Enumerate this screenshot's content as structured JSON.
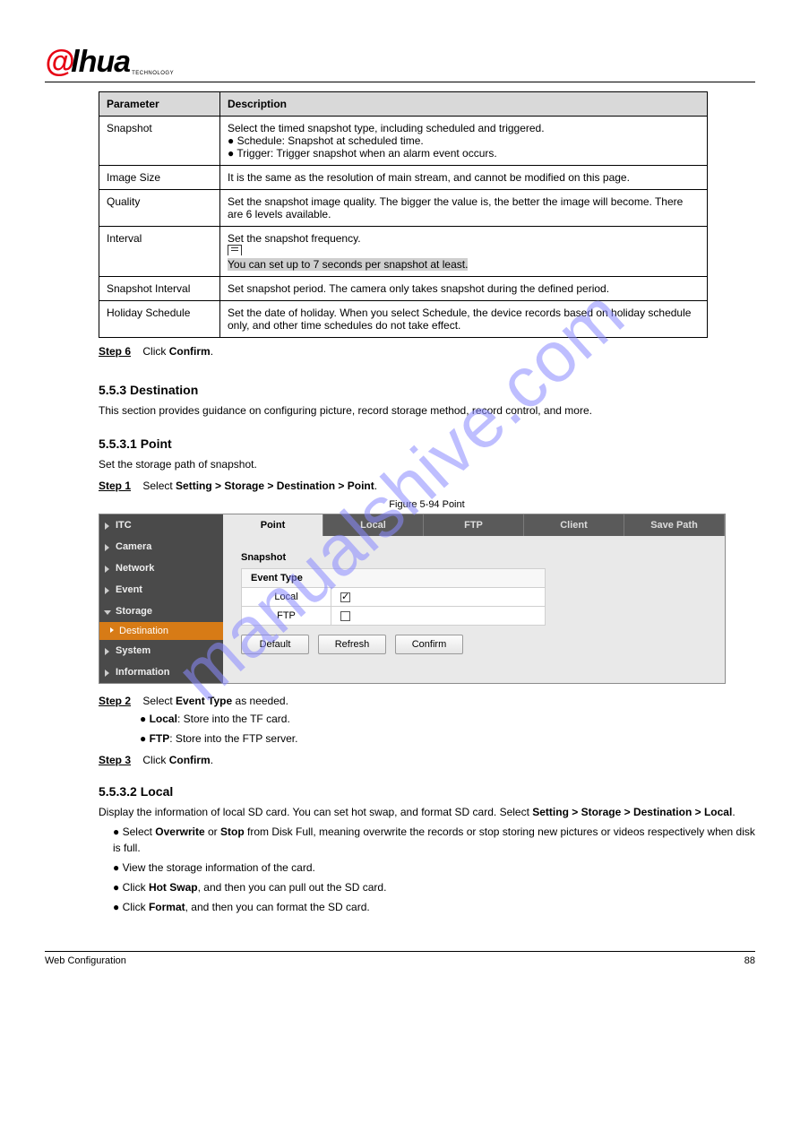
{
  "logo": {
    "first": "@",
    "second": "lhua",
    "tag": "TECHNOLOGY"
  },
  "watermark": "manualshive.com",
  "table": {
    "head": {
      "param": "Parameter",
      "desc": "Description"
    },
    "rows": [
      {
        "param": "Snapshot",
        "desc": "Select the timed snapshot type, including scheduled and triggered.\n● Schedule: Snapshot at scheduled time.\n● Trigger: Trigger snapshot when an alarm event occurs."
      },
      {
        "param": "Image Size",
        "desc": "It is the same as the resolution of main stream, and cannot be modified on this page."
      },
      {
        "param": "Quality",
        "desc": "Set the snapshot image quality. The bigger the value is, the better the image will become. There are 6 levels available."
      },
      {
        "param": "Interval",
        "desc_top": "Set the snapshot frequency.",
        "note": "You can set up to 7 seconds per snapshot at least."
      },
      {
        "param": "Snapshot Interval",
        "desc": "Set snapshot period. The camera only takes snapshot during the defined period."
      },
      {
        "param": "Holiday Schedule",
        "desc": "Set the date of holiday. When you select Schedule, the device records based on holiday schedule only, and other time schedules do not take effect."
      }
    ]
  },
  "step6": {
    "label": "Step 6",
    "text1": "Click ",
    "text2": "Confirm",
    "text3": "."
  },
  "sec1": {
    "heading": "5.5.3 Destination",
    "body": "This section provides guidance on configuring picture, record storage method, record control, and more."
  },
  "sec2": {
    "heading": "5.5.3.1 Point",
    "body": "Set the storage path of snapshot."
  },
  "step1": {
    "label": "Step 1",
    "text1": "Select ",
    "path": "Setting > Storage > Destination > Point",
    "text2": "."
  },
  "figcap1": "Figure 5-94 Point",
  "shot": {
    "sidebar": [
      "ITC",
      "Camera",
      "Network",
      "Event",
      "Storage"
    ],
    "sub": "Destination",
    "sidebar_after": [
      "System",
      "Information"
    ],
    "tabs": [
      "Point",
      "Local",
      "FTP",
      "Client",
      "Save Path"
    ],
    "panel_title": "Snapshot",
    "opts_head": "Event Type",
    "opts": [
      {
        "label": "Local",
        "checked": true
      },
      {
        "label": "FTP",
        "checked": false
      }
    ],
    "buttons": [
      "Default",
      "Refresh",
      "Confirm"
    ]
  },
  "step2": {
    "label": "Step 2",
    "text1": "Select ",
    "text2": "Event Type",
    "text3": " as needed."
  },
  "bullets": [
    {
      "k": "Local",
      "v": ": Store into the TF card."
    },
    {
      "k": "FTP",
      "v": ": Store into the FTP server."
    }
  ],
  "step3": {
    "label": "Step 3",
    "text1": "Click ",
    "text2": "Confirm",
    "text3": "."
  },
  "sec3": {
    "heading": "5.5.3.2 Local",
    "body1_pre": "Display the information of local SD card. You can set hot swap, and format SD card. Select ",
    "body1_path": "Setting > Storage > Destination > Local",
    "body1_post": ".",
    "bullets": [
      {
        "pre": "Select ",
        "b": "Overwrite",
        "mid": " or ",
        "b2": "Stop",
        "mid2": " from Disk Full, meaning overwrite the records or stop storing new pictures or videos respectively when disk is full."
      },
      {
        "txt": "View the storage information of the card."
      },
      {
        "pre": "Click ",
        "b": "Hot Swap",
        "post": ", and then you can pull out the SD card."
      },
      {
        "pre": "Click ",
        "b": "Format",
        "post": ", and then you can format the SD card."
      }
    ]
  },
  "footer": {
    "left": "Web Configuration",
    "right": "88"
  }
}
